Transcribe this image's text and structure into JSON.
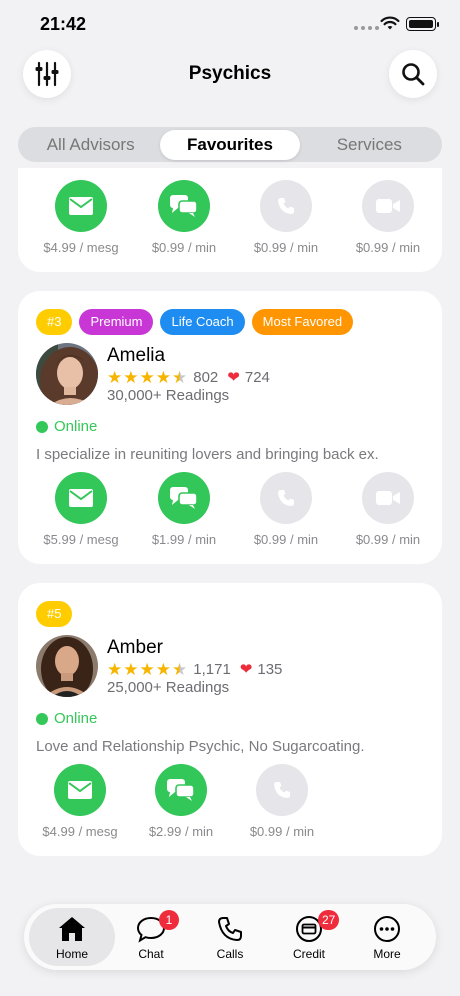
{
  "status_bar": {
    "time": "21:42"
  },
  "header": {
    "title": "Psychics"
  },
  "segments": [
    "All Advisors",
    "Favourites",
    "Services"
  ],
  "active_segment": "Favourites",
  "top_card": {
    "actions": [
      {
        "icon": "mail-icon",
        "price": "$4.99 / mesg",
        "available": true
      },
      {
        "icon": "chat-icon",
        "price": "$0.99 / min",
        "available": true
      },
      {
        "icon": "phone-icon",
        "price": "$0.99 / min",
        "available": false
      },
      {
        "icon": "video-icon",
        "price": "$0.99 / min",
        "available": false
      }
    ]
  },
  "advisors": [
    {
      "name": "Amelia",
      "badges": [
        "#3",
        "Premium",
        "Life Coach",
        "Most Favored"
      ],
      "rating": 4.5,
      "rating_count": "802",
      "likes": "724",
      "readings": "30,000+ Readings",
      "status": "Online",
      "description": "I specialize in reuniting lovers and bringing back ex.",
      "actions": [
        {
          "icon": "mail-icon",
          "price": "$5.99 / mesg",
          "available": true
        },
        {
          "icon": "chat-icon",
          "price": "$1.99 / min",
          "available": true
        },
        {
          "icon": "phone-icon",
          "price": "$0.99 / min",
          "available": false
        },
        {
          "icon": "video-icon",
          "price": "$0.99 / min",
          "available": false
        }
      ]
    },
    {
      "name": "Amber",
      "badges": [
        "#5"
      ],
      "rating": 4.5,
      "rating_count": "1,171",
      "likes": "135",
      "readings": "25,000+ Readings",
      "status": "Online",
      "description": "Love and Relationship Psychic, No Sugarcoating.",
      "actions": [
        {
          "icon": "mail-icon",
          "price": "$4.99 / mesg",
          "available": true
        },
        {
          "icon": "chat-icon",
          "price": "$2.99 / min",
          "available": true
        },
        {
          "icon": "phone-icon",
          "price": "$0.99 / min",
          "available": false
        }
      ]
    }
  ],
  "tab_bar": {
    "items": [
      {
        "label": "Home",
        "icon": "home-icon",
        "badge": ""
      },
      {
        "label": "Chat",
        "icon": "chat-bubble-icon",
        "badge": "1"
      },
      {
        "label": "Calls",
        "icon": "phone-icon",
        "badge": ""
      },
      {
        "label": "Credit",
        "icon": "credit-icon",
        "badge": "27"
      },
      {
        "label": "More",
        "icon": "more-icon",
        "badge": ""
      }
    ],
    "active": "Home"
  },
  "colors": {
    "available_green": "#33c659",
    "unavailable_gray": "#e5e5ea",
    "online_green": "#34c759",
    "star_gold": "#f7b500",
    "heart_red": "#ee2c3c",
    "badge_red": "#ee2c3c",
    "rank_yellow": "#ffcc00",
    "premium_purple": "#c837d6",
    "life_coach_blue": "#1e8cf0",
    "most_favored_orange": "#ff9500"
  }
}
